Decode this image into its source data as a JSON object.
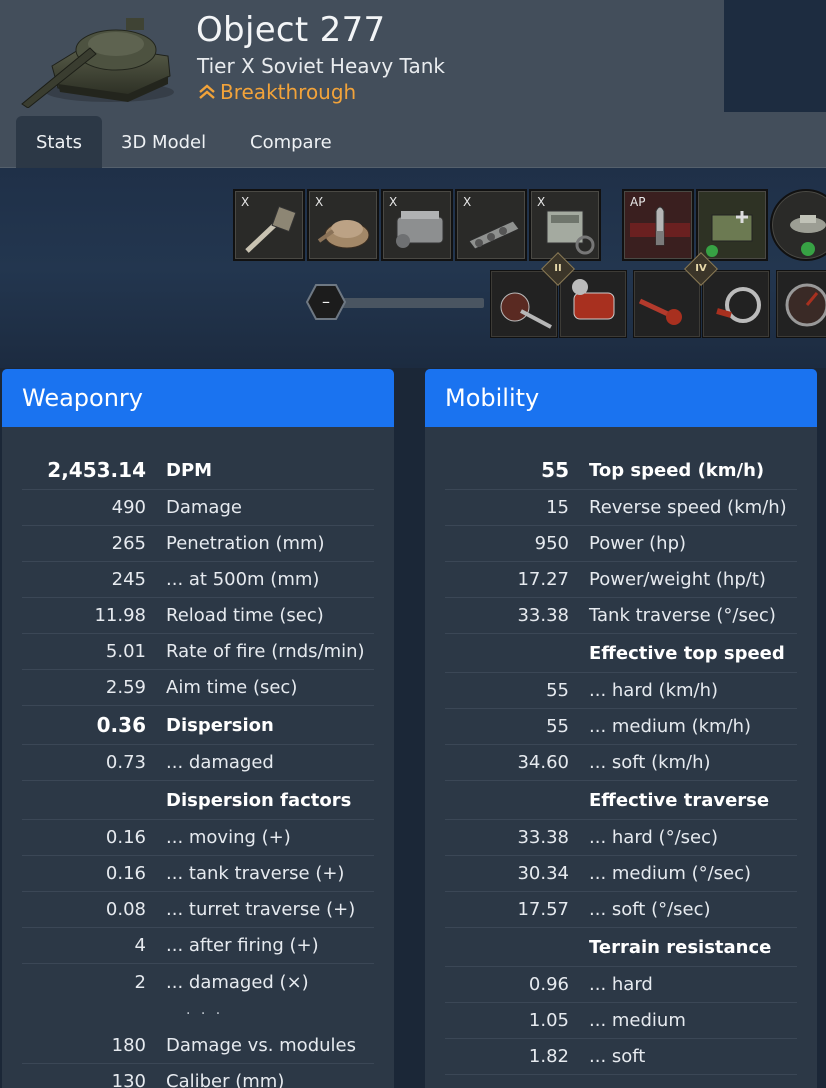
{
  "header": {
    "tank_name": "Object 277",
    "subtitle": "Tier X Soviet Heavy Tank",
    "role": "Breakthrough",
    "role_color": "#f2a33a"
  },
  "tabs": [
    {
      "label": "Stats",
      "active": true
    },
    {
      "label": "3D Model",
      "active": false
    },
    {
      "label": "Compare",
      "active": false
    }
  ],
  "modules": [
    {
      "tier": "X",
      "icon": "gun-icon"
    },
    {
      "tier": "X",
      "icon": "turret-icon"
    },
    {
      "tier": "X",
      "icon": "engine-icon"
    },
    {
      "tier": "X",
      "icon": "suspension-icon"
    },
    {
      "tier": "X",
      "icon": "radio-icon"
    }
  ],
  "ammo": [
    {
      "label": "AP",
      "icon": "shell-icon"
    },
    {
      "label": "",
      "icon": "consumable-kit-icon"
    },
    {
      "label": "",
      "icon": "tank-upgrade-icon"
    }
  ],
  "equipment_locks": [
    "II",
    "IV"
  ],
  "slider": {
    "label": "–"
  },
  "weaponry": {
    "title": "Weaponry",
    "rows": [
      {
        "value": "2,453.14",
        "label": "DPM",
        "style": "big"
      },
      {
        "value": "490",
        "label": "Damage",
        "style": ""
      },
      {
        "value": "265",
        "label": "Penetration (mm)",
        "style": ""
      },
      {
        "value": "245",
        "label": "... at 500m (mm)",
        "style": ""
      },
      {
        "value": "11.98",
        "label": "Reload time (sec)",
        "style": ""
      },
      {
        "value": "5.01",
        "label": "Rate of fire (rnds/min)",
        "style": ""
      },
      {
        "value": "2.59",
        "label": "Aim time (sec)",
        "style": ""
      },
      {
        "value": "0.36",
        "label": "Dispersion",
        "style": "big"
      },
      {
        "value": "0.73",
        "label": "... damaged",
        "style": ""
      },
      {
        "value": "",
        "label": "Dispersion factors",
        "style": "hdr"
      },
      {
        "value": "0.16",
        "label": "... moving (+)",
        "style": ""
      },
      {
        "value": "0.16",
        "label": "... tank traverse (+)",
        "style": ""
      },
      {
        "value": "0.08",
        "label": "... turret traverse (+)",
        "style": ""
      },
      {
        "value": "4",
        "label": "... after firing (+)",
        "style": ""
      },
      {
        "value": "2",
        "label": "... damaged (×)",
        "style": "noline"
      }
    ],
    "ellipsis": "· · ·",
    "rows_after": [
      {
        "value": "180",
        "label": "Damage vs. modules",
        "style": ""
      },
      {
        "value": "130",
        "label": "Caliber (mm)",
        "style": ""
      }
    ]
  },
  "mobility": {
    "title": "Mobility",
    "rows": [
      {
        "value": "55",
        "label": "Top speed (km/h)",
        "style": "big"
      },
      {
        "value": "15",
        "label": "Reverse speed (km/h)",
        "style": ""
      },
      {
        "value": "950",
        "label": "Power (hp)",
        "style": ""
      },
      {
        "value": "17.27",
        "label": "Power/weight (hp/t)",
        "style": ""
      },
      {
        "value": "33.38",
        "label": "Tank traverse (°/sec)",
        "style": ""
      },
      {
        "value": "",
        "label": "Effective top speed",
        "style": "hdr"
      },
      {
        "value": "55",
        "label": "... hard (km/h)",
        "style": ""
      },
      {
        "value": "55",
        "label": "... medium (km/h)",
        "style": ""
      },
      {
        "value": "34.60",
        "label": "... soft (km/h)",
        "style": ""
      },
      {
        "value": "",
        "label": "Effective traverse",
        "style": "hdr"
      },
      {
        "value": "33.38",
        "label": "... hard (°/sec)",
        "style": ""
      },
      {
        "value": "30.34",
        "label": "... medium (°/sec)",
        "style": ""
      },
      {
        "value": "17.57",
        "label": "... soft (°/sec)",
        "style": ""
      },
      {
        "value": "",
        "label": "Terrain resistance",
        "style": "hdr"
      },
      {
        "value": "0.96",
        "label": "... hard",
        "style": ""
      },
      {
        "value": "1.05",
        "label": "... medium",
        "style": ""
      },
      {
        "value": "1.82",
        "label": "... soft",
        "style": ""
      }
    ]
  }
}
